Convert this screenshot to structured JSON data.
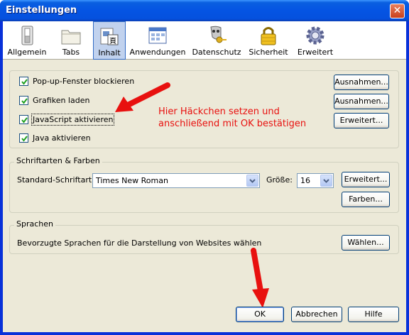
{
  "window": {
    "title": "Einstellungen",
    "close_icon": "close-icon"
  },
  "toolbar": {
    "items": [
      {
        "label": "Allgemein",
        "icon": "switch-icon"
      },
      {
        "label": "Tabs",
        "icon": "folder-icon"
      },
      {
        "label": "Inhalt",
        "icon": "content-page-icon"
      },
      {
        "label": "Anwendungen",
        "icon": "applications-icon"
      },
      {
        "label": "Datenschutz",
        "icon": "mask-key-icon"
      },
      {
        "label": "Sicherheit",
        "icon": "padlock-icon"
      },
      {
        "label": "Erweitert",
        "icon": "gear-icon"
      }
    ],
    "active": "Inhalt"
  },
  "content": {
    "checkboxes": [
      {
        "label": "Pop-up-Fenster blockieren",
        "checked": true
      },
      {
        "label": "Grafiken laden",
        "checked": true
      },
      {
        "label": "JavaScript aktivieren",
        "checked": true
      },
      {
        "label": "Java aktivieren",
        "checked": true
      }
    ],
    "buttons": {
      "exceptions_1": "Ausnahmen...",
      "exceptions_2": "Ausnahmen...",
      "advanced": "Erweitert..."
    }
  },
  "fonts": {
    "legend": "Schriftarten & Farben",
    "default_font_label": "Standard-Schriftart:",
    "default_font_value": "Times New Roman",
    "size_label": "Größe:",
    "size_value": "16",
    "advanced_button": "Erweitert...",
    "colors_button": "Farben..."
  },
  "languages": {
    "legend": "Sprachen",
    "description": "Bevorzugte Sprachen für die Darstellung von Websites wählen",
    "choose_button": "Wählen..."
  },
  "annotation": {
    "line1": "Hier Häckchen setzen und",
    "line2": "anschließend mit OK bestätigen",
    "color": "#e8110f"
  },
  "footer": {
    "ok": "OK",
    "cancel": "Abbrechen",
    "help": "Hilfe"
  },
  "colors": {
    "titlebar": "#0554e3",
    "dialog_bg": "#ece9d8",
    "active_tab": "#c1d2ee"
  }
}
